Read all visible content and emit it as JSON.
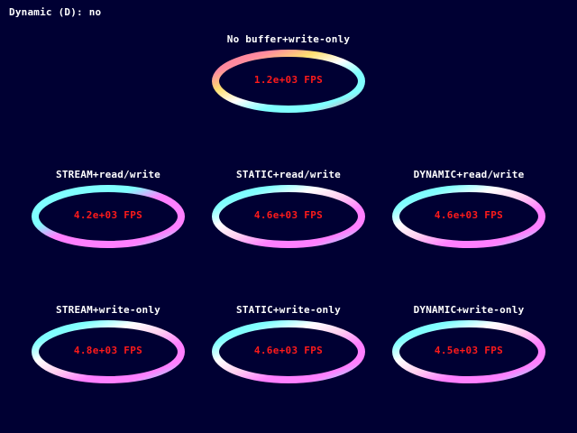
{
  "status": {
    "text": "Dynamic (D): no"
  },
  "panels": [
    {
      "title": "No buffer+write-only",
      "fps": "1.2e+03 FPS",
      "gradient": [
        "#ff8090",
        "#ff8aa0",
        "#ffe070",
        "#ffffff",
        "#80ffff",
        "#80ffff",
        "#ff8090"
      ]
    },
    {
      "title": "STREAM+read/write",
      "fps": "4.2e+03 FPS",
      "gradient": [
        "#80ffff",
        "#80ffff",
        "#80ffff",
        "#ff80ff",
        "#ff80ff",
        "#ff80ff",
        "#80ffff"
      ]
    },
    {
      "title": "STATIC+read/write",
      "fps": "4.6e+03 FPS",
      "gradient": [
        "#80ffff",
        "#80ffff",
        "#ffffff",
        "#ffd0f0",
        "#ff80ff",
        "#ff80ff",
        "#80ffff"
      ]
    },
    {
      "title": "DYNAMIC+read/write",
      "fps": "4.6e+03 FPS",
      "gradient": [
        "#80ffff",
        "#80ffff",
        "#ffffff",
        "#ffd0f0",
        "#ff80ff",
        "#ff80ff",
        "#80ffff"
      ]
    },
    {
      "title": "STREAM+write-only",
      "fps": "4.8e+03 FPS",
      "gradient": [
        "#80ffff",
        "#80ffff",
        "#ffffff",
        "#ffd0f0",
        "#ff80ff",
        "#ff80ff",
        "#80ffff"
      ]
    },
    {
      "title": "STATIC+write-only",
      "fps": "4.6e+03 FPS",
      "gradient": [
        "#80ffff",
        "#80ffff",
        "#ffffff",
        "#ffd0f0",
        "#ff80ff",
        "#ff80ff",
        "#80ffff"
      ]
    },
    {
      "title": "DYNAMIC+write-only",
      "fps": "4.5e+03 FPS",
      "gradient": [
        "#80ffff",
        "#80ffff",
        "#ffffff",
        "#ffd0f0",
        "#ff80ff",
        "#ff80ff",
        "#80ffff"
      ]
    }
  ],
  "colors": {
    "background": "#000033",
    "label": "#ffffff",
    "fps": "#ff1a1a"
  }
}
